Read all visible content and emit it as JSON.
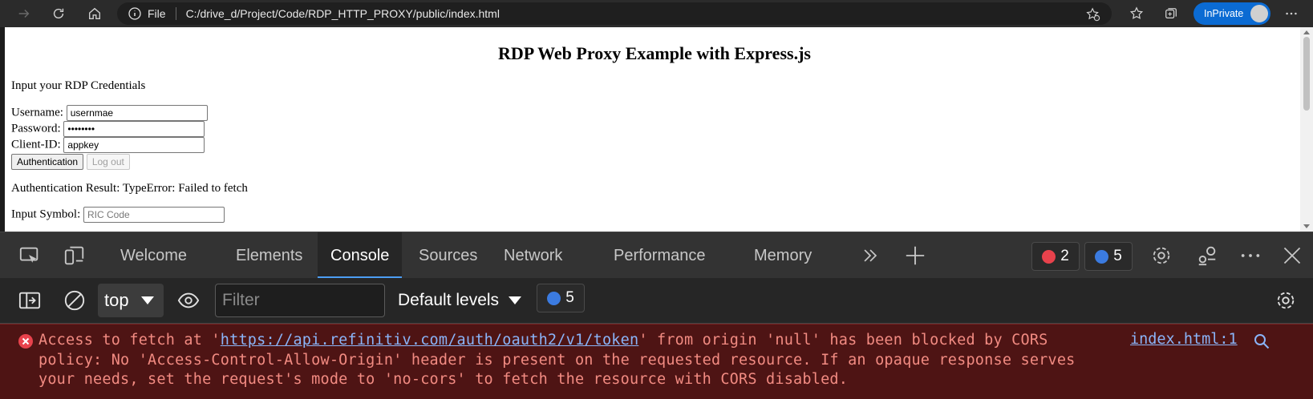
{
  "browser": {
    "address_scheme": "File",
    "url": "C:/drive_d/Project/Code/RDP_HTTP_PROXY/public/index.html",
    "inprivate_label": "InPrivate"
  },
  "page": {
    "title": "RDP Web Proxy Example with Express.js",
    "intro": "Input your RDP Credentials",
    "username_label": "Username:",
    "username_value": "usernmae",
    "password_label": "Password:",
    "password_value": "••••••••",
    "client_id_label": "Client-ID:",
    "client_id_value": "appkey",
    "auth_button": "Authentication",
    "logout_button": "Log out",
    "auth_result": "Authentication Result: TypeError: Failed to fetch",
    "symbol_label": "Input Symbol:",
    "symbol_placeholder": "RIC Code"
  },
  "devtools": {
    "tabs": [
      "Welcome",
      "Elements",
      "Console",
      "Sources",
      "Network",
      "Performance",
      "Memory"
    ],
    "active_tab": "Console",
    "error_count": "2",
    "message_count": "5",
    "context": "top",
    "filter_placeholder": "Filter",
    "levels": "Default levels",
    "issues_count": "5"
  },
  "console": {
    "error_prefix": "Access to fetch at '",
    "error_link": "https://api.refinitiv.com/auth/oauth2/v1/token",
    "error_line1_rest": "' from origin 'null' has been blocked by CORS",
    "error_line2": "policy: No 'Access-Control-Allow-Origin' header is present on the requested resource. If an opaque response serves",
    "error_line3": "your needs, set the request's mode to 'no-cors' to fetch the resource with CORS disabled.",
    "error_source": "index.html:1"
  },
  "colors": {
    "accent": "#4c9df3",
    "error_text": "#f28b82",
    "error_bg": "#4e1414",
    "inprivate": "#0b6bd3"
  }
}
